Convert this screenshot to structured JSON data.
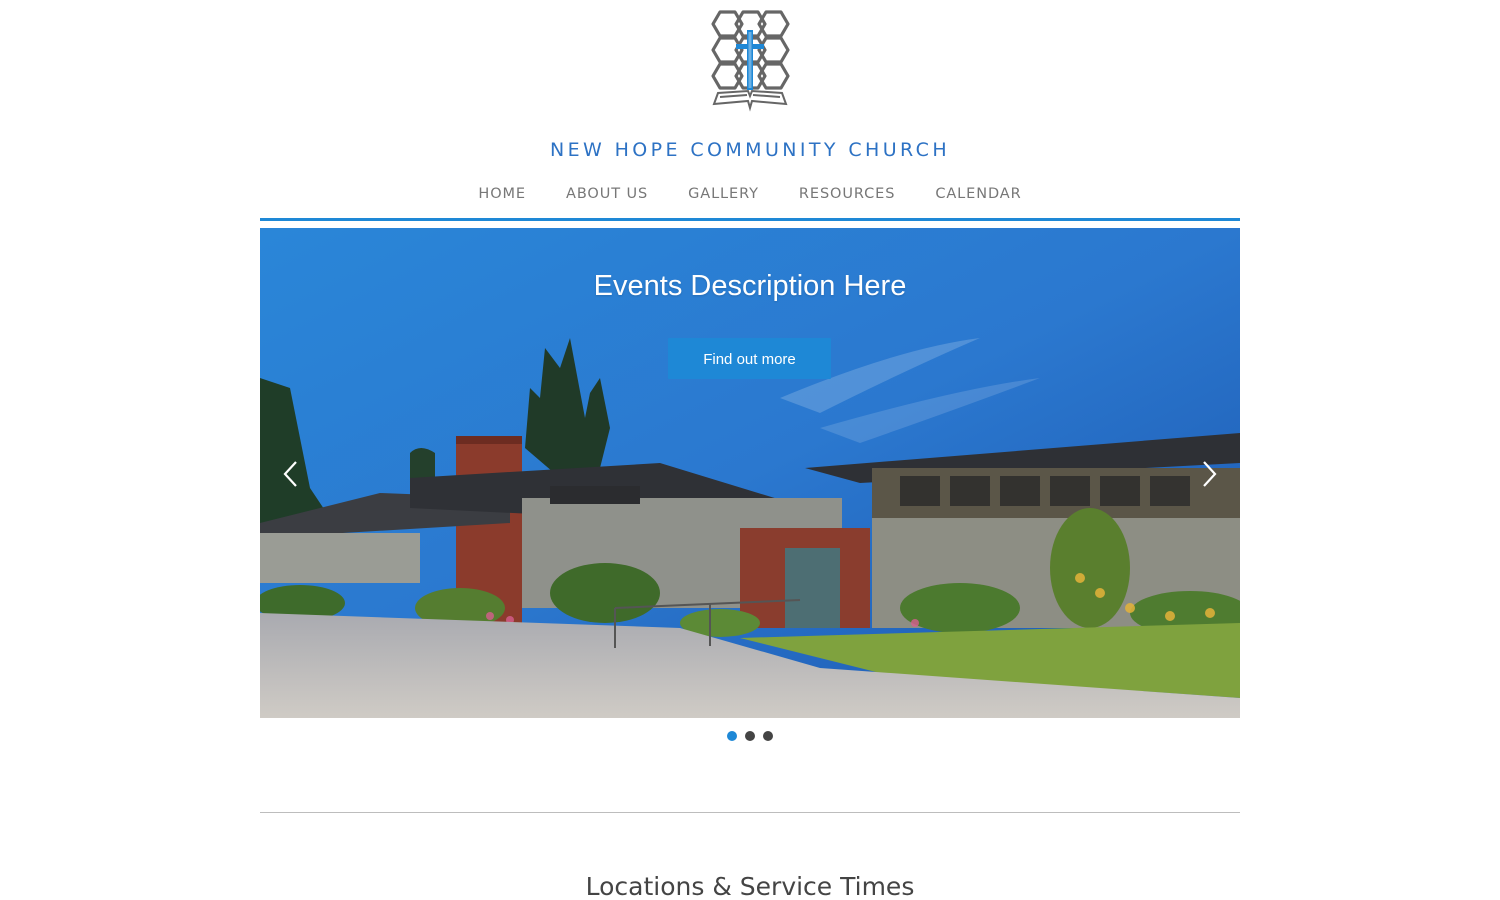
{
  "site": {
    "title": "NEW HOPE COMMUNITY CHURCH",
    "logo_icon": "hexagon-cross-bible-logo",
    "accent_color": "#1e88d6",
    "title_color": "#2d72c4"
  },
  "nav": {
    "items": [
      {
        "label": "HOME"
      },
      {
        "label": "ABOUT US"
      },
      {
        "label": "GALLERY"
      },
      {
        "label": "RESOURCES"
      },
      {
        "label": "CALENDAR"
      }
    ]
  },
  "slider": {
    "heading": "Events Description Here",
    "button_label": "Find out more",
    "prev_icon": "chevron-left-icon",
    "next_icon": "chevron-right-icon",
    "slide_count": 3,
    "active_slide": 1
  },
  "section": {
    "heading": "Locations & Service Times"
  }
}
